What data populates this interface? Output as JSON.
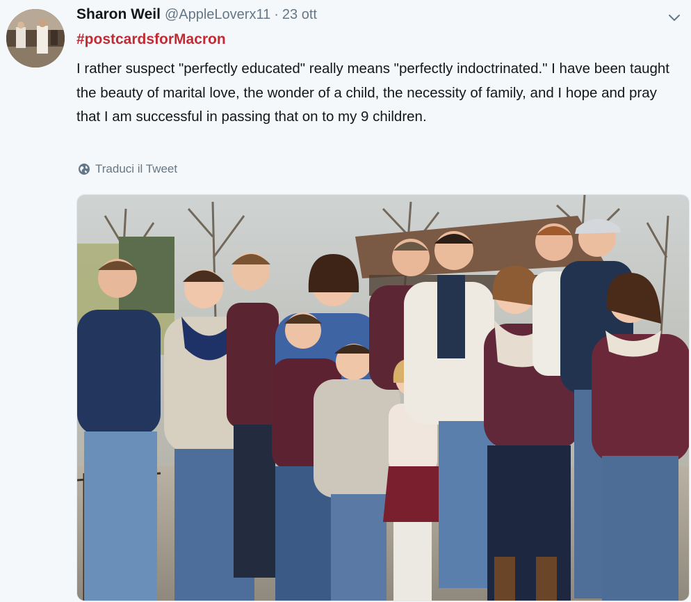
{
  "tweet": {
    "author": {
      "display_name": "Sharon Weil",
      "handle": "@AppleLoverx11"
    },
    "separator": "·",
    "timestamp": "23 ott",
    "hashtag": "#postcardsforMacron",
    "text": "I rather suspect \"perfectly educated\" really means \"perfectly indoctrinated.\" I have been taught the beauty of marital love, the wonder of a child, the necessity of family, and I hope and pray that I am successful in passing that on to my 9 children.",
    "translate_label": "Traduci il Tweet",
    "icons": {
      "more": "chevron-down-icon",
      "translate": "globe-icon"
    },
    "colors": {
      "hashtag": "#c22a34",
      "secondary_text": "#657786",
      "background": "#f5f8fa"
    }
  }
}
